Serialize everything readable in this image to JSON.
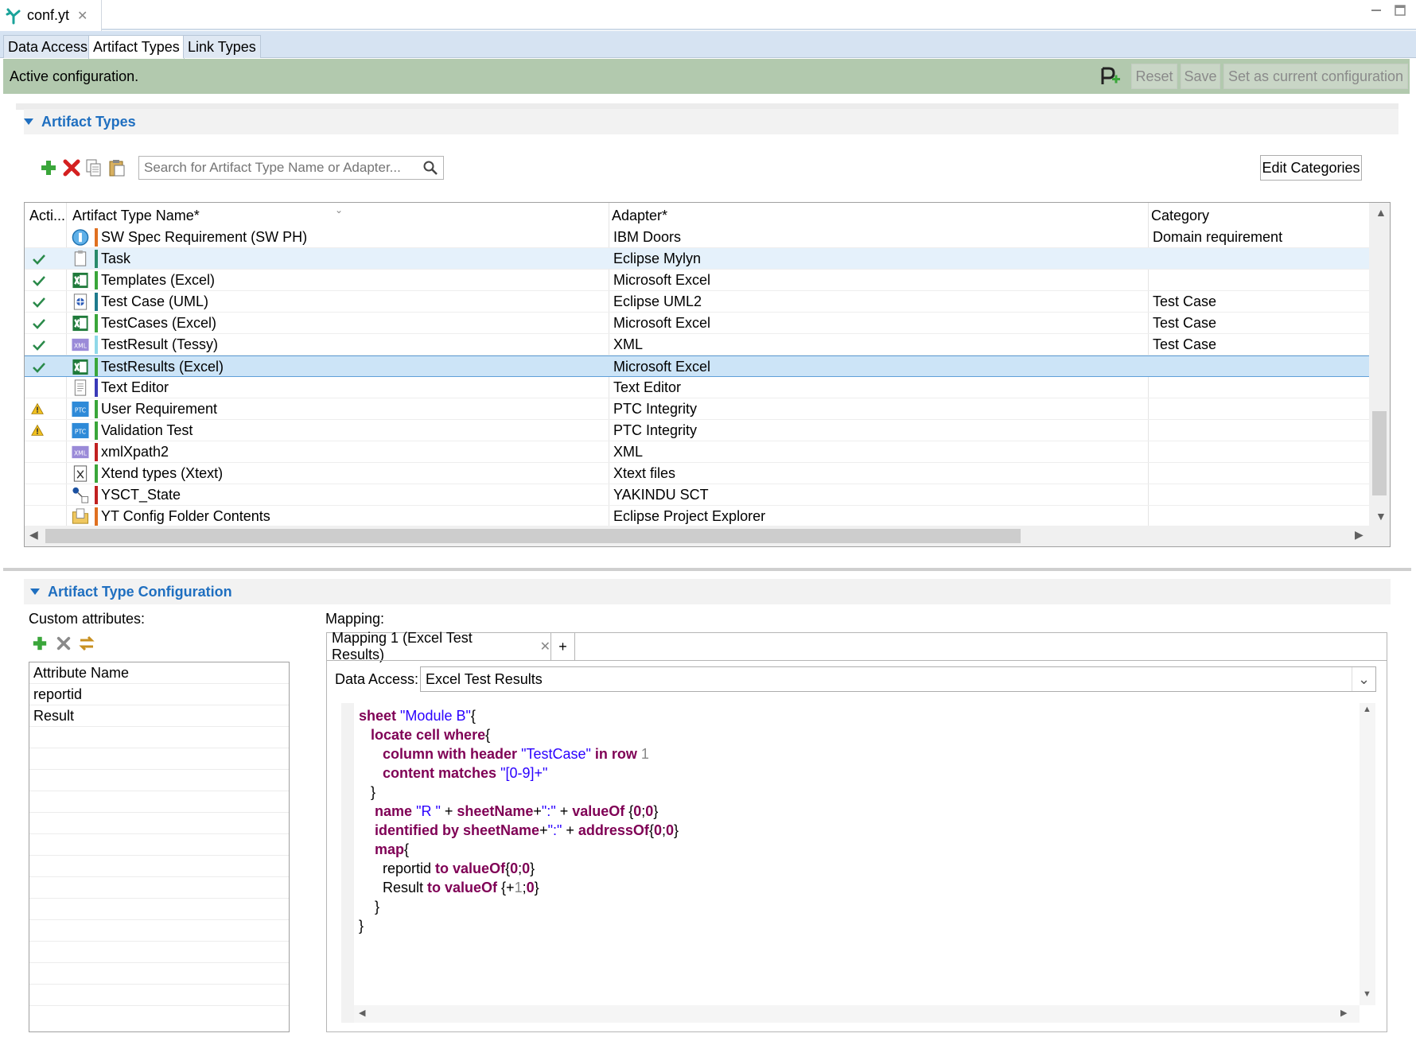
{
  "editor_tab": {
    "title": "conf.yt",
    "close": "✕",
    "icon": "yt-logo-icon"
  },
  "window_controls": [
    "minimize-icon",
    "maximize-icon"
  ],
  "page_tabs": [
    {
      "label": "Data Access",
      "active": false
    },
    {
      "label": "Artifact Types",
      "active": true
    },
    {
      "label": "Link Types",
      "active": false
    }
  ],
  "status": {
    "text": "Active configuration.",
    "reset": "Reset",
    "save": "Save",
    "set_current": "Set as current configuration"
  },
  "artifact_types_section": {
    "title": "Artifact Types",
    "search_placeholder": "Search for Artifact Type Name or Adapter...",
    "edit_categories": "Edit Categories",
    "columns": {
      "active": "Acti...",
      "name": "Artifact Type Name*",
      "adapter": "Adapter*",
      "category": "Category"
    },
    "rows": [
      {
        "status": "",
        "icon": "doors-icon",
        "bar": "#e07020",
        "name": "SW Spec Requirement (SW PH)",
        "adapter": "IBM Doors",
        "category": "Domain requirement"
      },
      {
        "status": "check",
        "icon": "task-icon",
        "bar": "#2a8a6a",
        "name": "Task",
        "adapter": "Eclipse Mylyn",
        "category": ""
      },
      {
        "status": "check",
        "icon": "excel-icon",
        "bar": "#3aa63a",
        "name": "Templates (Excel)",
        "adapter": "Microsoft Excel",
        "category": ""
      },
      {
        "status": "check",
        "icon": "uml-icon",
        "bar": "#1e7a8c",
        "name": "Test Case (UML)",
        "adapter": "Eclipse UML2",
        "category": "Test Case"
      },
      {
        "status": "check",
        "icon": "excel-icon",
        "bar": "#3aa63a",
        "name": "TestCases (Excel)",
        "adapter": "Microsoft Excel",
        "category": "Test Case"
      },
      {
        "status": "check",
        "icon": "xml-icon",
        "bar": "#8fd8e8",
        "name": "TestResult (Tessy)",
        "adapter": "XML",
        "category": "Test Case"
      },
      {
        "status": "check",
        "icon": "excel-icon",
        "bar": "#3aa63a",
        "name": "TestResults (Excel)",
        "adapter": "Microsoft Excel",
        "category": ""
      },
      {
        "status": "",
        "icon": "text-file-icon",
        "bar": "#3a3ab8",
        "name": "Text Editor",
        "adapter": "Text Editor",
        "category": ""
      },
      {
        "status": "warn",
        "icon": "ptc-icon",
        "bar": "#3aa63a",
        "name": "User Requirement",
        "adapter": "PTC Integrity",
        "category": ""
      },
      {
        "status": "warn",
        "icon": "ptc-icon",
        "bar": "#3aa63a",
        "name": "Validation Test",
        "adapter": "PTC Integrity",
        "category": ""
      },
      {
        "status": "",
        "icon": "xml-icon",
        "bar": "#c02020",
        "name": "xmlXpath2",
        "adapter": "XML",
        "category": ""
      },
      {
        "status": "",
        "icon": "xtext-icon",
        "bar": "#3aa63a",
        "name": "Xtend types (Xtext)",
        "adapter": "Xtext files",
        "category": ""
      },
      {
        "status": "",
        "icon": "statechart-icon",
        "bar": "#c02020",
        "name": "YSCT_State",
        "adapter": "YAKINDU SCT",
        "category": ""
      },
      {
        "status": "",
        "icon": "folder-icon",
        "bar": "#e07020",
        "name": "YT Config Folder Contents",
        "adapter": "Eclipse Project Explorer",
        "category": ""
      }
    ]
  },
  "configuration_section": {
    "title": "Artifact Type Configuration",
    "custom_attributes_label": "Custom attributes:",
    "attributes_header": "Attribute Name",
    "attributes": [
      "reportid",
      "Result"
    ],
    "mapping_label": "Mapping:",
    "mapping_tab": "Mapping 1 (Excel Test Results)",
    "mapping_add": "+",
    "data_access_label": "Data Access:",
    "data_access_value": "Excel Test Results"
  },
  "colors": {
    "accent": "#1f6fc0",
    "status_bar": "#b2c9ae",
    "selection": "#cce4f7",
    "keyword": "#7f0055",
    "string": "#2a00ff"
  }
}
